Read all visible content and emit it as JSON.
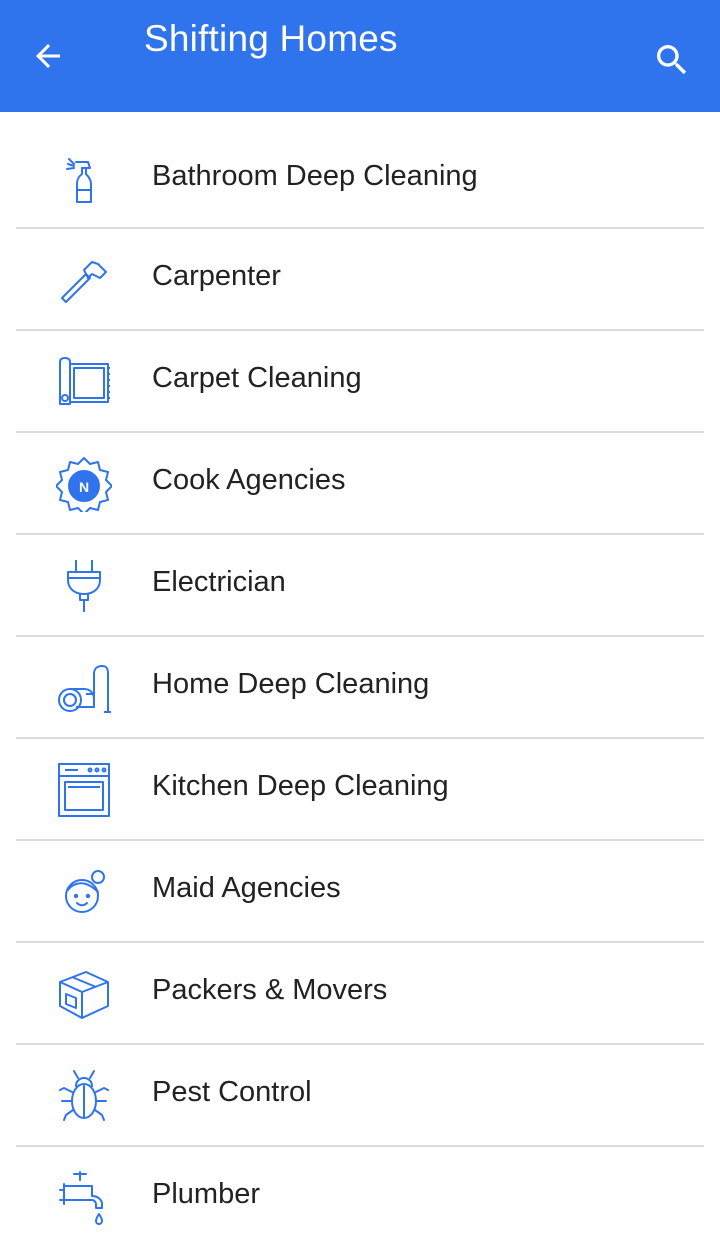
{
  "appbar": {
    "title": "Shifting Homes",
    "back_icon": "arrow-back-icon",
    "search_icon": "search-icon",
    "background_color": "#2f74ec"
  },
  "accent_color": "#2f74ec",
  "services": [
    {
      "label": "Bathroom Deep Cleaning",
      "icon": "spray-bottle-icon"
    },
    {
      "label": "Carpenter",
      "icon": "hammer-icon"
    },
    {
      "label": "Carpet Cleaning",
      "icon": "carpet-roll-icon"
    },
    {
      "label": "Cook Agencies",
      "icon": "cook-badge-icon"
    },
    {
      "label": "Electrician",
      "icon": "plug-icon"
    },
    {
      "label": "Home Deep Cleaning",
      "icon": "vacuum-cleaner-icon"
    },
    {
      "label": "Kitchen Deep Cleaning",
      "icon": "oven-icon"
    },
    {
      "label": "Maid Agencies",
      "icon": "maid-icon"
    },
    {
      "label": "Packers & Movers",
      "icon": "box-icon"
    },
    {
      "label": "Pest Control",
      "icon": "bug-icon"
    },
    {
      "label": "Plumber",
      "icon": "faucet-icon"
    }
  ]
}
